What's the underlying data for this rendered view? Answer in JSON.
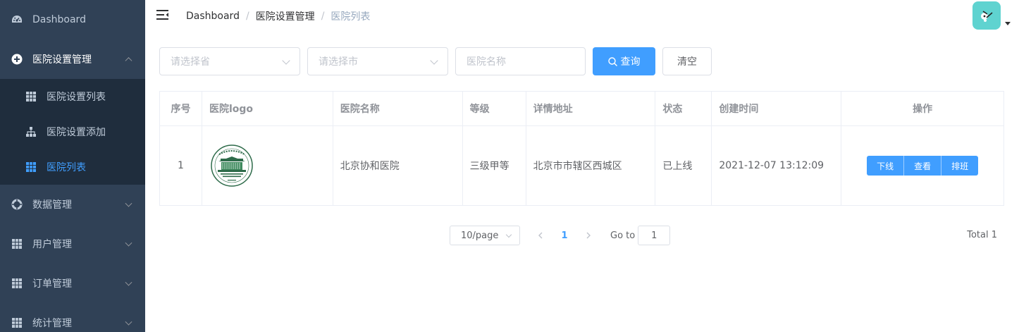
{
  "sidebar": {
    "items": [
      {
        "label": "Dashboard",
        "icon": "dashboard-icon"
      },
      {
        "label": "医院设置管理",
        "icon": "plus-circle-icon"
      },
      {
        "label": "数据管理",
        "icon": "lifebuoy-icon"
      },
      {
        "label": "用户管理",
        "icon": "table-icon"
      },
      {
        "label": "订单管理",
        "icon": "table-icon"
      },
      {
        "label": "统计管理",
        "icon": "table-icon"
      }
    ],
    "submenu": [
      {
        "label": "医院设置列表",
        "icon": "table-icon"
      },
      {
        "label": "医院设置添加",
        "icon": "tree-icon"
      },
      {
        "label": "医院列表",
        "icon": "table-icon"
      }
    ]
  },
  "breadcrumb": [
    "Dashboard",
    "医院设置管理",
    "医院列表"
  ],
  "filters": {
    "province_placeholder": "请选择省",
    "city_placeholder": "请选择市",
    "name_placeholder": "医院名称",
    "search_label": "查询",
    "clear_label": "清空"
  },
  "table": {
    "headers": [
      "序号",
      "医院logo",
      "医院名称",
      "等级",
      "详情地址",
      "状态",
      "创建时间",
      "操作"
    ],
    "rows": [
      {
        "index": "1",
        "name": "北京协和医院",
        "level": "三级甲等",
        "address": "北京市市辖区西城区",
        "status": "已上线",
        "created": "2021-12-07 13:12:09",
        "actions": [
          "下线",
          "查看",
          "排班"
        ]
      }
    ]
  },
  "pagination": {
    "page_size": "10/page",
    "current_page": "1",
    "goto_label": "Go to",
    "goto_value": "1",
    "total": "Total 1"
  },
  "colors": {
    "sidebar_bg": "#304156",
    "submenu_bg": "#1f2d3d",
    "primary": "#409eff",
    "avatar_bg": "#5fd3d0"
  }
}
